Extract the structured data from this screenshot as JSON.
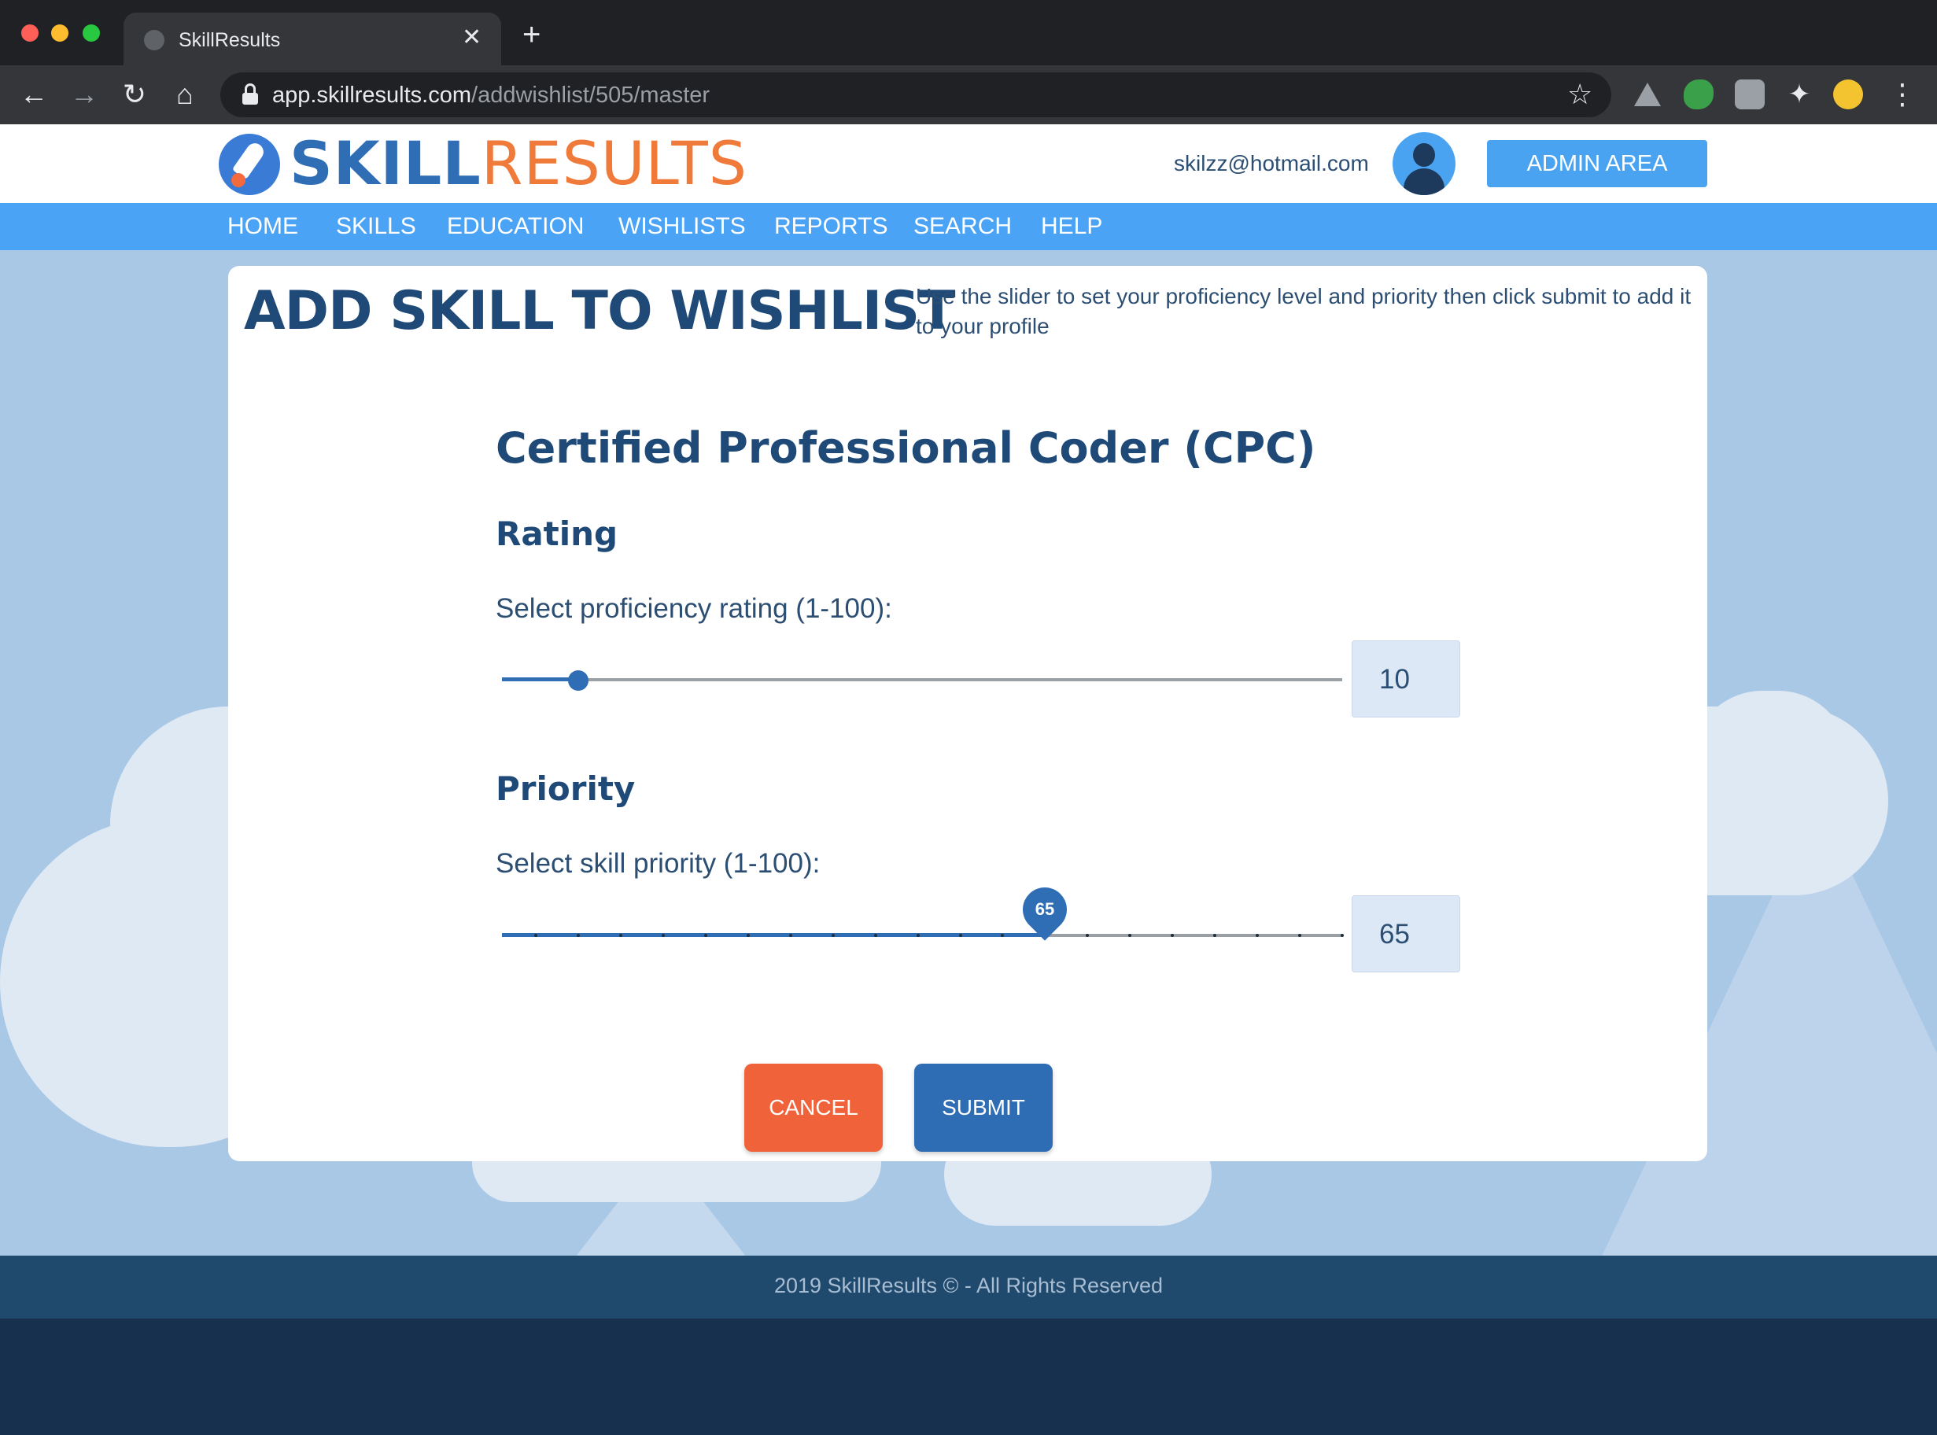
{
  "browser": {
    "tab_title": "SkillResults",
    "url_host": "app.skillresults.com",
    "url_path": "/addwishlist/505/master"
  },
  "header": {
    "logo_part1": "SKILL",
    "logo_part2": "RESULTS",
    "user_email": "skilzz@hotmail.com",
    "admin_button": "ADMIN AREA"
  },
  "nav": {
    "items": [
      "HOME",
      "SKILLS",
      "EDUCATION",
      "WISHLISTS",
      "REPORTS",
      "SEARCH",
      "HELP"
    ]
  },
  "page": {
    "title": "ADD SKILL TO WISHLIST",
    "description": "Use the slider to set your proficiency level and priority then click submit to add it to your profile",
    "skill_name": "Certified Professional Coder (CPC)",
    "rating_heading": "Rating",
    "rating_label": "Select proficiency rating (1-100):",
    "rating_value": "10",
    "priority_heading": "Priority",
    "priority_label": "Select skill priority (1-100):",
    "priority_value": "65",
    "priority_pin": "65",
    "cancel_button": "CANCEL",
    "submit_button": "SUBMIT"
  },
  "sliders": {
    "rating": {
      "min": 1,
      "max": 100,
      "value": 10
    },
    "priority": {
      "min": 1,
      "max": 100,
      "value": 65,
      "step": 5
    }
  },
  "footer": {
    "text": "2019 SkillResults © - All Rights Reserved"
  },
  "colors": {
    "brand_blue": "#2f6db5",
    "brand_orange": "#f07a3a",
    "nav_blue": "#4ba3f5",
    "cancel_orange": "#f0623a"
  }
}
